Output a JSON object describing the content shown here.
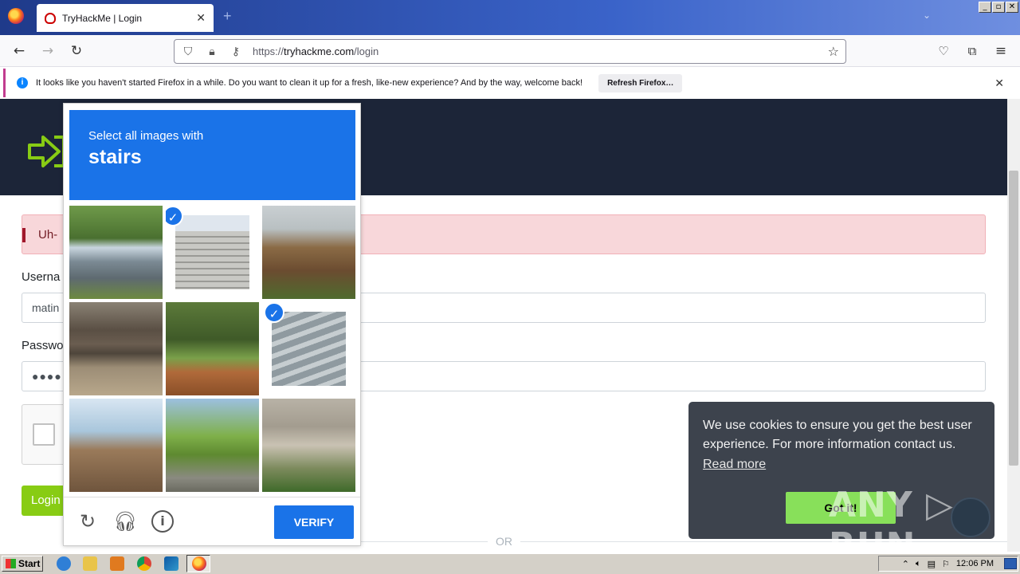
{
  "browser": {
    "tab_title": "TryHackMe | Login",
    "tab_close": "✕",
    "new_tab": "+",
    "tab_list": "⌄",
    "url_host": "tryhackme.com",
    "url_prefix": "https://",
    "url_path": "/login",
    "window_controls": [
      "_",
      "▫",
      "✕"
    ]
  },
  "notification": {
    "message": "It looks like you haven't started Firefox in a while. Do you want to clean it up for a fresh, like-new experience? And by the way, welcome back!",
    "button": "Refresh Firefox…",
    "close": "✕"
  },
  "page": {
    "alert_text": "Uh-",
    "username_label": "Userna",
    "username_value": "matin",
    "password_label": "Passwo",
    "password_value": "●●●●●",
    "login_button": "Login",
    "or_text": "OR"
  },
  "captcha": {
    "instruction": "Select all images with",
    "target": "stairs",
    "verify_button": "VERIFY",
    "check_mark": "✓",
    "tiles": [
      {
        "selected": false,
        "scene": "house-roof-tree"
      },
      {
        "selected": true,
        "scene": "white-stairs"
      },
      {
        "selected": false,
        "scene": "house-pole"
      },
      {
        "selected": false,
        "scene": "rail-ties"
      },
      {
        "selected": false,
        "scene": "garden-fence"
      },
      {
        "selected": true,
        "scene": "concrete-steps"
      },
      {
        "selected": false,
        "scene": "brick-building"
      },
      {
        "selected": false,
        "scene": "street-trees"
      },
      {
        "selected": false,
        "scene": "porch-steps"
      }
    ],
    "icons": [
      "reload-icon",
      "headphones-icon",
      "info-icon"
    ]
  },
  "cookie": {
    "message": "We use cookies to ensure you get the best user experience. For more information contact us.",
    "read_more": "Read more",
    "got_it": "Got it!"
  },
  "watermark": "ANY ▷ RUN",
  "taskbar": {
    "start": "Start",
    "clock": "12:06 PM"
  },
  "colors": {
    "captcha_blue": "#1a73e8",
    "hero_dark": "#1c2538",
    "thm_green": "#88cc14",
    "cookie_bg": "#3d434d"
  }
}
